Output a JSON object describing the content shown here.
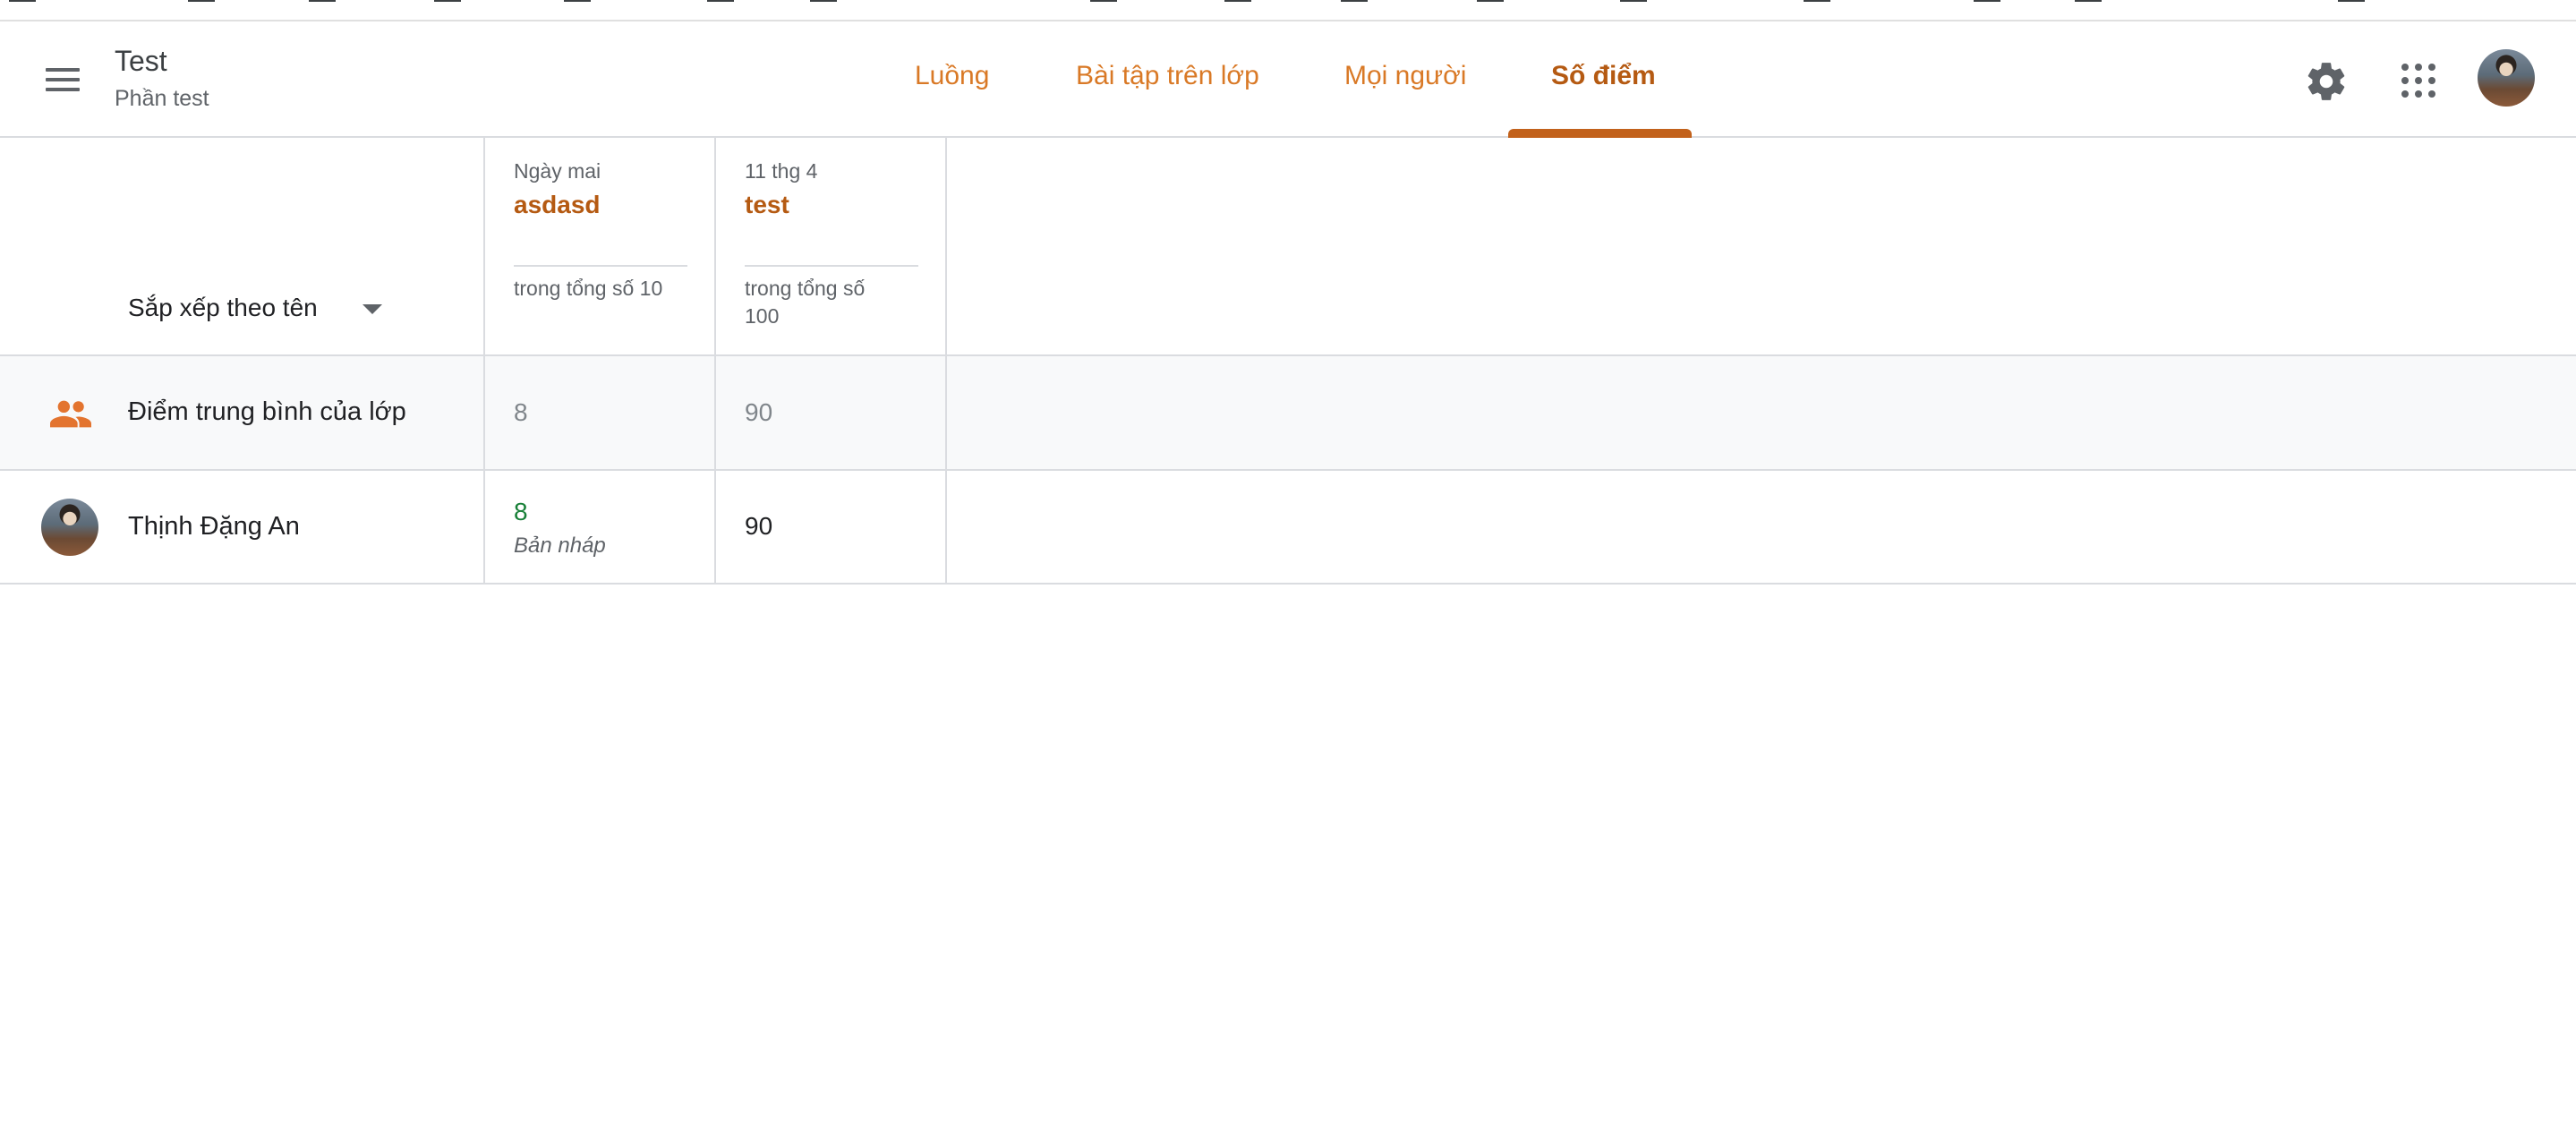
{
  "header": {
    "class_title": "Test",
    "class_section": "Phần test",
    "tabs": [
      {
        "label": "Luồng"
      },
      {
        "label": "Bài tập trên lớp"
      },
      {
        "label": "Mọi người"
      },
      {
        "label": "Số điểm",
        "active": true
      }
    ]
  },
  "gradebook": {
    "sort_label": "Sắp xếp theo tên",
    "assignments": [
      {
        "due": "Ngày mai",
        "title": "asdasd",
        "total_line1": "trong tổng số 10",
        "total_line2": ""
      },
      {
        "due": "11 thg 4",
        "title": "test",
        "total_line1": "trong tổng số",
        "total_line2": "100"
      }
    ],
    "class_average": {
      "label": "Điểm trung bình của lớp",
      "values": [
        "8",
        "90"
      ]
    },
    "students": [
      {
        "name": "Thịnh Đặng An",
        "grades": [
          {
            "value": "8",
            "status": "Bản nháp"
          },
          {
            "value": "90",
            "status": ""
          }
        ]
      }
    ]
  },
  "colors": {
    "accent": "#b55a12",
    "tab_text": "#d97926",
    "draft_grade": "#188038",
    "divider": "#dadce0",
    "row_highlight": "#f8f9fa"
  },
  "icons": {
    "menu": "hamburger-menu-icon",
    "settings": "gear-icon",
    "apps": "apps-grid-icon",
    "class_average": "people-icon",
    "sort": "caret-down-icon"
  }
}
